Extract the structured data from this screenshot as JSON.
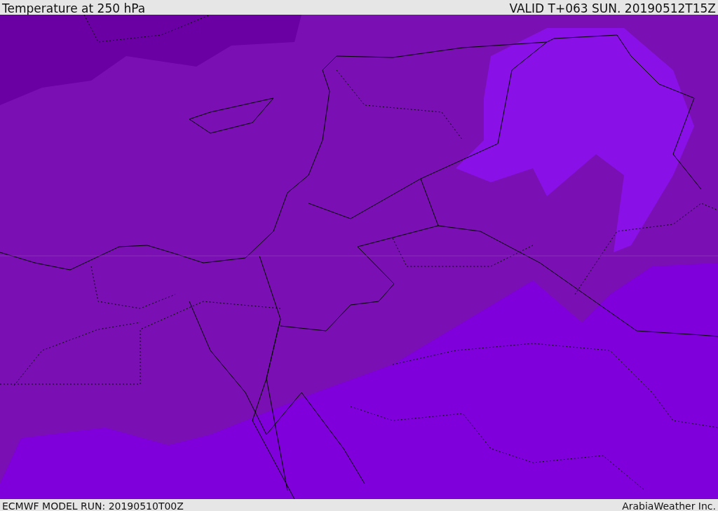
{
  "header": {
    "title": "Temperature at 250 hPa",
    "valid": "VALID T+063 SUN. 20190512T15Z"
  },
  "footer": {
    "model_run": "ECMWF MODEL RUN: 20190510T00Z",
    "credit": "ArabiaWeather Inc."
  }
}
